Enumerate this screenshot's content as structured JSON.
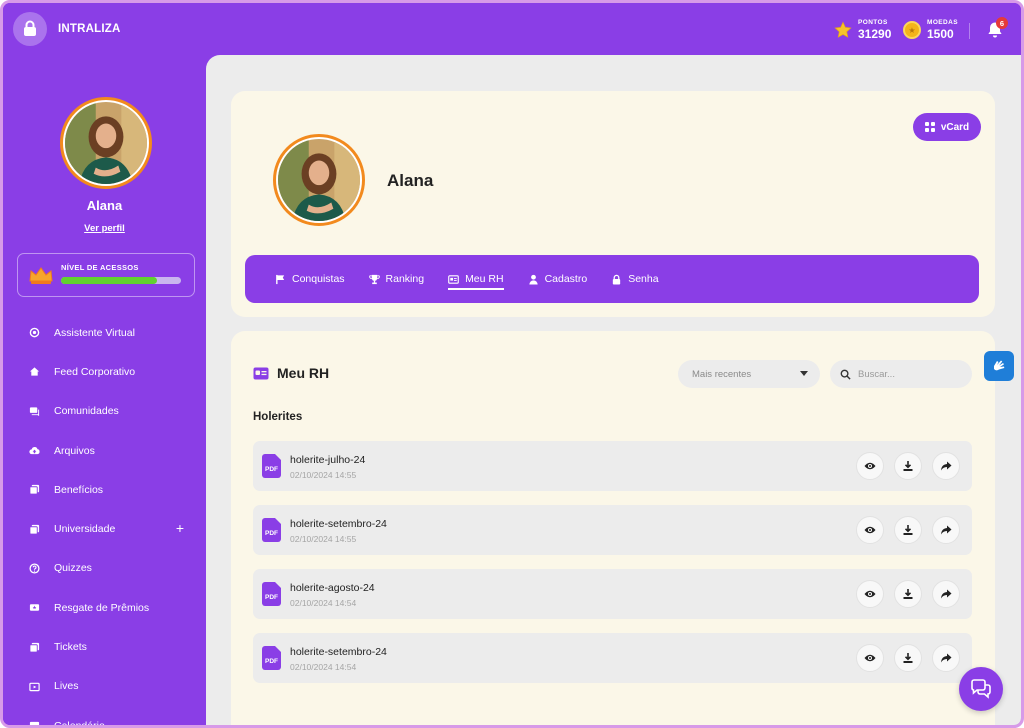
{
  "app": {
    "brand": "INTRALIZA"
  },
  "header": {
    "points": {
      "label": "PONTOS",
      "value": "31290"
    },
    "coins": {
      "label": "MOEDAS",
      "value": "1500"
    },
    "notifications": {
      "count": "6"
    }
  },
  "sidebar": {
    "user_name": "Alana",
    "profile_link": "Ver perfil",
    "level": {
      "label": "NÍVEL DE ACESSOS",
      "progress": 0.8
    },
    "items": [
      {
        "label": "Assistente Virtual",
        "icon": "assistant-icon"
      },
      {
        "label": "Feed Corporativo",
        "icon": "home-icon"
      },
      {
        "label": "Comunidades",
        "icon": "chat-icon"
      },
      {
        "label": "Arquivos",
        "icon": "cloud-upload-icon"
      },
      {
        "label": "Benefícios",
        "icon": "docs-icon"
      },
      {
        "label": "Universidade",
        "icon": "docs-icon",
        "expandable": true
      },
      {
        "label": "Quizzes",
        "icon": "question-icon"
      },
      {
        "label": "Resgate de Prêmios",
        "icon": "ticket-icon"
      },
      {
        "label": "Tickets",
        "icon": "docs-icon"
      },
      {
        "label": "Lives",
        "icon": "video-icon"
      },
      {
        "label": "Calendário",
        "icon": "calendar-icon"
      }
    ]
  },
  "profile": {
    "name": "Alana",
    "vcard_label": "vCard",
    "tabs": [
      {
        "label": "Conquistas",
        "icon": "flag-icon",
        "active": false
      },
      {
        "label": "Ranking",
        "icon": "trophy-icon",
        "active": false
      },
      {
        "label": "Meu RH",
        "icon": "id-card-icon",
        "active": true
      },
      {
        "label": "Cadastro",
        "icon": "user-icon",
        "active": false
      },
      {
        "label": "Senha",
        "icon": "lock-icon",
        "active": false
      }
    ]
  },
  "rh": {
    "title": "Meu RH",
    "sort": {
      "selected": "Mais recentes"
    },
    "search": {
      "placeholder": "Buscar..."
    },
    "section_title": "Holerites",
    "files": [
      {
        "name": "holerite-julho-24",
        "date": "02/10/2024 14:55"
      },
      {
        "name": "holerite-setembro-24",
        "date": "02/10/2024 14:55"
      },
      {
        "name": "holerite-agosto-24",
        "date": "02/10/2024 14:54"
      },
      {
        "name": "holerite-setembro-24",
        "date": "02/10/2024 14:54"
      }
    ]
  },
  "colors": {
    "primary": "#8a3ee6",
    "accent": "#f28a1e",
    "card": "#fbf7e8",
    "progress": "#61d12f"
  }
}
